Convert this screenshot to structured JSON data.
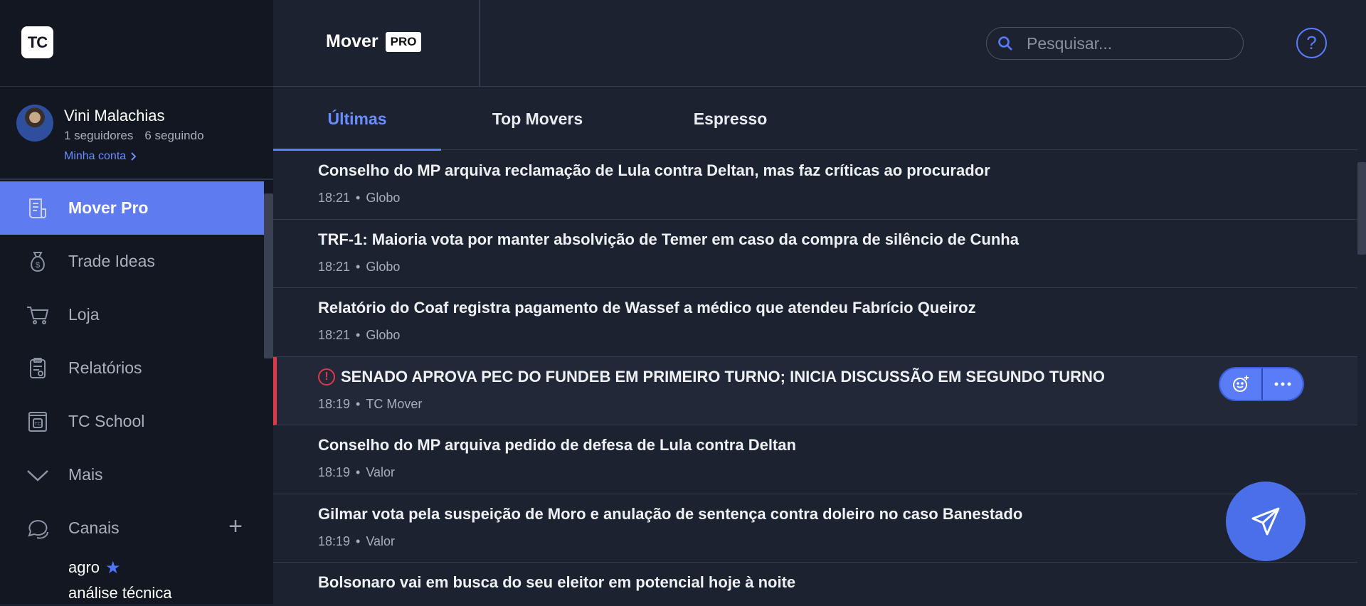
{
  "app": {
    "logo_text": "TC",
    "brand": "Mover",
    "brand_badge": "PRO"
  },
  "profile": {
    "name": "Vini Malachias",
    "followers": "1 seguidores",
    "following": "6 seguindo",
    "account_link": "Minha conta"
  },
  "sidebar": {
    "items": [
      {
        "label": "Mover Pro",
        "icon": "document-icon",
        "active": true
      },
      {
        "label": "Trade Ideas",
        "icon": "money-bag-icon"
      },
      {
        "label": "Loja",
        "icon": "cart-icon"
      },
      {
        "label": "Relatórios",
        "icon": "report-icon"
      },
      {
        "label": "TC School",
        "icon": "school-icon"
      },
      {
        "label": "Mais",
        "icon": "chevron-down-icon"
      },
      {
        "label": "Canais",
        "icon": "chat-icon"
      }
    ],
    "channels": [
      {
        "label": "agro",
        "starred": true
      },
      {
        "label": "análise técnica"
      }
    ]
  },
  "search": {
    "placeholder": "Pesquisar..."
  },
  "help": {
    "label": "?"
  },
  "tabs": [
    {
      "label": "Últimas",
      "active": true
    },
    {
      "label": "Top Movers"
    },
    {
      "label": "Espresso"
    }
  ],
  "feed": [
    {
      "title": "Conselho do MP arquiva reclamação de Lula contra Deltan, mas faz críticas ao procurador",
      "time": "18:21",
      "source": "Globo"
    },
    {
      "title": "TRF-1: Maioria vota por manter absolvição de Temer em caso da compra de silêncio de Cunha",
      "time": "18:21",
      "source": "Globo"
    },
    {
      "title": "Relatório do Coaf registra pagamento de Wassef a médico que atendeu Fabrício Queiroz",
      "time": "18:21",
      "source": "Globo"
    },
    {
      "title": "SENADO APROVA PEC DO FUNDEB EM PRIMEIRO TURNO; INICIA DISCUSSÃO EM SEGUNDO TURNO",
      "time": "18:19",
      "source": "TC Mover",
      "alert": true
    },
    {
      "title": "Conselho do MP arquiva pedido de defesa de Lula contra Deltan",
      "time": "18:19",
      "source": "Valor"
    },
    {
      "title": "Gilmar vota pela suspeição de Moro e anulação de sentença contra doleiro no caso Banestado",
      "time": "18:19",
      "source": "Valor"
    },
    {
      "title": "Bolsonaro vai em busca do seu eleitor em potencial hoje à noite",
      "time": "",
      "source": ""
    }
  ],
  "meta_separator": "•",
  "colors": {
    "accent": "#5e7cf0",
    "alert": "#e0374a",
    "background": "#1c2230",
    "sidebar": "#121722"
  }
}
